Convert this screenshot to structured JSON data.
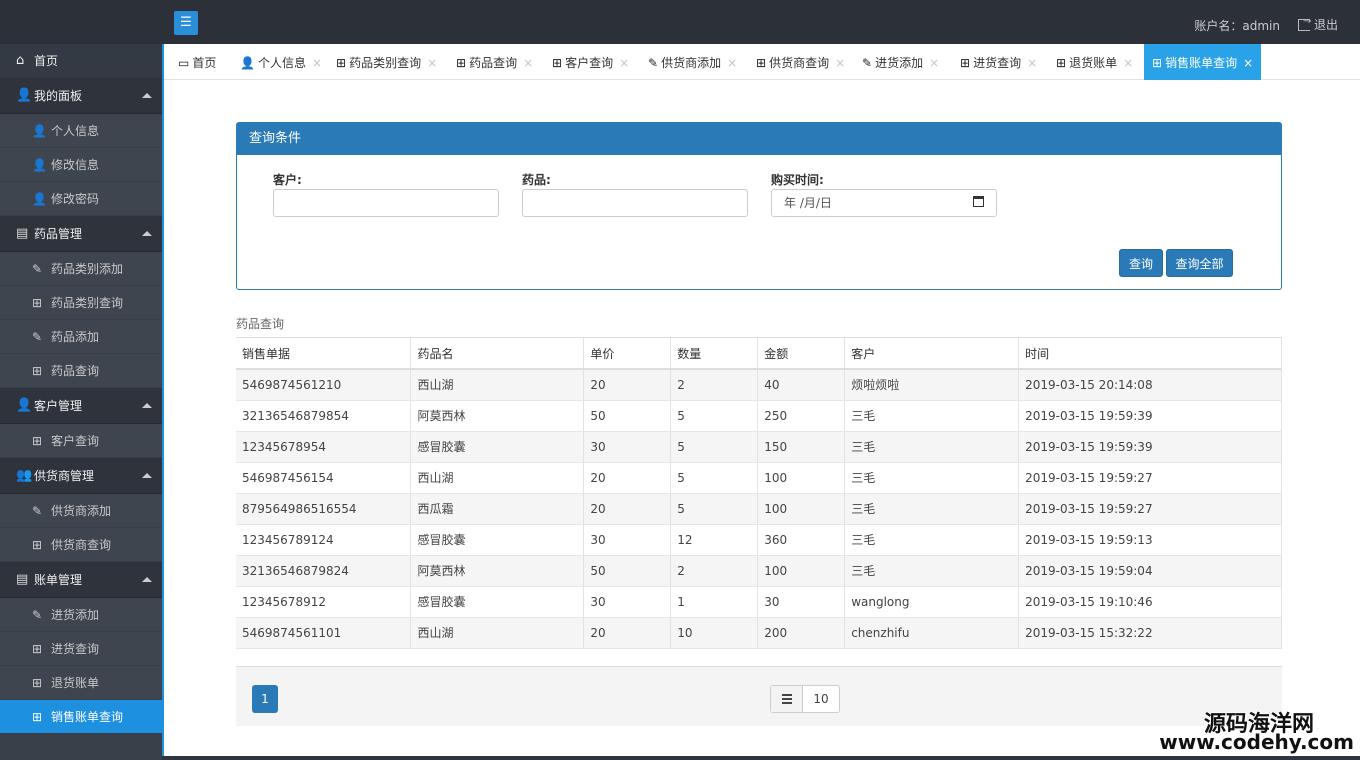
{
  "topbar": {
    "menu_icon": "☰",
    "account": "账户名：admin",
    "logout": "退出"
  },
  "sidebar": {
    "home": "首页",
    "groups": [
      {
        "label": "我的面板",
        "icon": "user-icon",
        "items": [
          "个人信息",
          "修改信息",
          "修改密码"
        ]
      },
      {
        "label": "药品管理",
        "icon": "document-icon",
        "items": [
          "药品类别添加",
          "药品类别查询",
          "药品添加",
          "药品查询"
        ]
      },
      {
        "label": "客户管理",
        "icon": "user-icon",
        "items": [
          "客户查询"
        ]
      },
      {
        "label": "供货商管理",
        "icon": "users-icon",
        "items": [
          "供货商添加",
          "供货商查询"
        ]
      },
      {
        "label": "账单管理",
        "icon": "document-icon",
        "items": [
          "进货添加",
          "进货查询",
          "退货账单",
          "销售账单查询"
        ]
      }
    ]
  },
  "tabs": [
    "首页",
    "个人信息",
    "药品类别查询",
    "药品查询",
    "客户查询",
    "供货商添加",
    "供货商查询",
    "进货添加",
    "进货查询",
    "退货账单",
    "销售账单查询"
  ],
  "tab_close": "×",
  "query": {
    "title": "查询条件",
    "customer_label": "客户:",
    "drug_label": "药品:",
    "time_label": "购买时间:",
    "date_placeholder": "年 /月/日",
    "search_btn": "查询",
    "search_all_btn": "查询全部"
  },
  "table": {
    "caption": "药品查询",
    "headers": [
      "销售单据",
      "药品名",
      "单价",
      "数量",
      "金额",
      "客户",
      "时间"
    ],
    "rows": [
      [
        "5469874561210",
        "西山湖",
        "20",
        "2",
        "40",
        "烦啦烦啦",
        "2019-03-15 20:14:08"
      ],
      [
        "32136546879854",
        "阿莫西林",
        "50",
        "5",
        "250",
        "三毛",
        "2019-03-15 19:59:39"
      ],
      [
        "12345678954",
        "感冒胶囊",
        "30",
        "5",
        "150",
        "三毛",
        "2019-03-15 19:59:39"
      ],
      [
        "546987456154",
        "西山湖",
        "20",
        "5",
        "100",
        "三毛",
        "2019-03-15 19:59:27"
      ],
      [
        "879564986516554",
        "西瓜霜",
        "20",
        "5",
        "100",
        "三毛",
        "2019-03-15 19:59:27"
      ],
      [
        "123456789124",
        "感冒胶囊",
        "30",
        "12",
        "360",
        "三毛",
        "2019-03-15 19:59:13"
      ],
      [
        "32136546879824",
        "阿莫西林",
        "50",
        "2",
        "100",
        "三毛",
        "2019-03-15 19:59:04"
      ],
      [
        "12345678912",
        "感冒胶囊",
        "30",
        "1",
        "30",
        "wanglong",
        "2019-03-15 19:10:46"
      ],
      [
        "5469874561101",
        "西山湖",
        "20",
        "10",
        "200",
        "chenzhifu",
        "2019-03-15 15:32:22"
      ]
    ]
  },
  "pager": {
    "current_page": "1",
    "page_size": "10"
  },
  "watermark": {
    "cn": "源码海洋网",
    "url": "www.codehy.com"
  },
  "colors": {
    "accent": "#2a7ab8",
    "active_tab": "#2aa2e8",
    "sidebar_active": "#1e90e0"
  }
}
